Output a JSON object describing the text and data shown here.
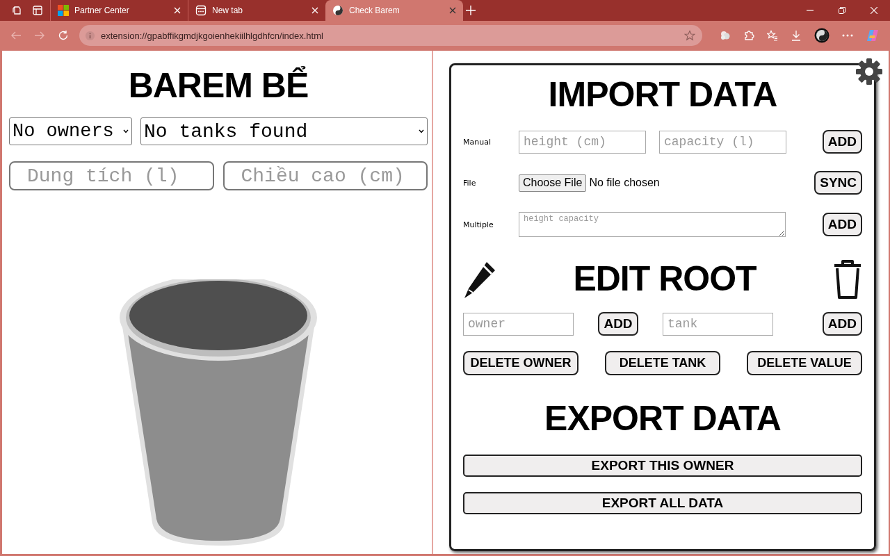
{
  "browser": {
    "tabs": [
      {
        "title": "Partner Center",
        "selected": false,
        "kind": "grid"
      },
      {
        "title": "New tab",
        "selected": false,
        "kind": "newtab"
      },
      {
        "title": "Check Barem",
        "selected": true,
        "kind": "page"
      }
    ],
    "address": "extension://gpabffikgmdjkgoienhekiilhlgdhfcn/index.html"
  },
  "left": {
    "title": "BAREM BỂ",
    "owner_select": "No owners",
    "tank_select": "No tanks found",
    "capacity_field": {
      "placeholder": "Dung tích (l)"
    },
    "height_field": {
      "placeholder": "Chiều cao (cm)"
    }
  },
  "import": {
    "title": "IMPORT DATA",
    "rows": [
      {
        "kind": "fields",
        "label": "Manual",
        "fields": [
          {
            "placeholder": "height (cm)"
          },
          {
            "placeholder": "capacity (l)"
          }
        ],
        "button": "ADD"
      },
      {
        "kind": "file",
        "label": "File",
        "file_button": "Choose File",
        "file_status": "No file chosen",
        "button": "SYNC"
      },
      {
        "kind": "textarea",
        "label": "Multiple",
        "placeholder": "height capacity",
        "button": "ADD"
      }
    ]
  },
  "edit": {
    "title": "EDIT ROOT",
    "owner_field": {
      "placeholder": "owner"
    },
    "owner_button": "ADD",
    "tank_field": {
      "placeholder": "tank"
    },
    "tank_button": "ADD",
    "delete_buttons": [
      "DELETE OWNER",
      "DELETE TANK",
      "DELETE VALUE"
    ]
  },
  "export": {
    "title": "EXPORT DATA",
    "buttons": [
      "EXPORT THIS OWNER",
      "EXPORT ALL DATA"
    ]
  }
}
